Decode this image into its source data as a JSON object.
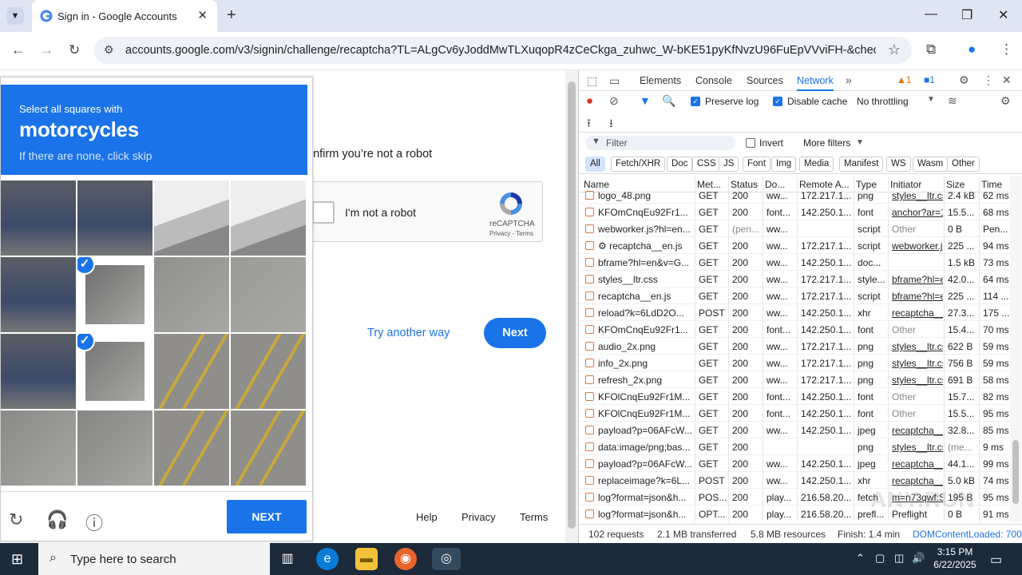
{
  "browser": {
    "tab_title": "Sign in - Google Accounts",
    "url": "accounts.google.com/v3/signin/challenge/recaptcha?TL=ALgCv6yJoddMwTLXuqopR4zCeCkga_zuhwc_W-bKE51pyKfNvzU96FuEpVVviFH-&checkConn..."
  },
  "page": {
    "robot_line": "onfirm you’re not a robot",
    "checkbox_label": "I'm not a robot",
    "recaptcha_brand": "reCAPTCHA",
    "privacy_terms": "Privacy - Terms",
    "try_another": "Try another way",
    "next": "Next",
    "footer": {
      "help": "Help",
      "privacy": "Privacy",
      "terms": "Terms"
    }
  },
  "captcha": {
    "instruction": "Select all squares with",
    "target": "motorcycles",
    "hint": "If there are none, click skip",
    "verify": "NEXT",
    "selected_tiles": [
      5,
      9
    ]
  },
  "devtools": {
    "tabs": [
      "Elements",
      "Console",
      "Sources",
      "Network"
    ],
    "active_tab": "Network",
    "warnings": "1",
    "messages": "1",
    "preserve_log": "Preserve log",
    "disable_cache": "Disable cache",
    "throttling": "No throttling",
    "filter_placeholder": "Filter",
    "invert": "Invert",
    "more_filters": "More filters",
    "type_filters": [
      "All",
      "Fetch/XHR",
      "Doc",
      "CSS",
      "JS",
      "Font",
      "Img",
      "Media",
      "Manifest",
      "WS",
      "Wasm",
      "Other"
    ],
    "columns": [
      "Name",
      "Met...",
      "Status",
      "Do...",
      "Remote A...",
      "Type",
      "Initiator",
      "Size",
      "Time"
    ],
    "rows": [
      [
        "logo_48.png",
        "GET",
        "200",
        "ww...",
        "172.217.1...",
        "png",
        "styles__ltr.css",
        "2.4 kB",
        "62 ms"
      ],
      [
        "KFOmCnqEu92Fr1...",
        "GET",
        "200",
        "font...",
        "142.250.1...",
        "font",
        "anchor?ar=1",
        "15.5...",
        "68 ms"
      ],
      [
        "webworker.js?hl=en...",
        "GET",
        "(pen...",
        "ww...",
        "",
        "script",
        "Other",
        "0 B",
        "Pen..."
      ],
      [
        "⚙ recaptcha__en.js",
        "GET",
        "200",
        "ww...",
        "172.217.1...",
        "script",
        "webworker.js",
        "225 ...",
        "94 ms"
      ],
      [
        "bframe?hl=en&v=G...",
        "GET",
        "200",
        "ww...",
        "142.250.1...",
        "doc...",
        "",
        "1.5 kB",
        "73 ms"
      ],
      [
        "styles__ltr.css",
        "GET",
        "200",
        "ww...",
        "172.217.1...",
        "style...",
        "bframe?hl=e",
        "42.0...",
        "64 ms"
      ],
      [
        "recaptcha__en.js",
        "GET",
        "200",
        "ww...",
        "172.217.1...",
        "script",
        "bframe?hl=e",
        "225 ...",
        "114 ..."
      ],
      [
        "reload?k=6LdD2O...",
        "POST",
        "200",
        "ww...",
        "142.250.1...",
        "xhr",
        "recaptcha__e",
        "27.3...",
        "175 ..."
      ],
      [
        "KFOmCnqEu92Fr1...",
        "GET",
        "200",
        "font...",
        "142.250.1...",
        "font",
        "Other",
        "15.4...",
        "70 ms"
      ],
      [
        "audio_2x.png",
        "GET",
        "200",
        "ww...",
        "172.217.1...",
        "png",
        "styles__ltr.css",
        "622 B",
        "59 ms"
      ],
      [
        "info_2x.png",
        "GET",
        "200",
        "ww...",
        "172.217.1...",
        "png",
        "styles__ltr.css",
        "756 B",
        "59 ms"
      ],
      [
        "refresh_2x.png",
        "GET",
        "200",
        "ww...",
        "172.217.1...",
        "png",
        "styles__ltr.css",
        "691 B",
        "58 ms"
      ],
      [
        "KFOlCnqEu92Fr1M...",
        "GET",
        "200",
        "font...",
        "142.250.1...",
        "font",
        "Other",
        "15.7...",
        "82 ms"
      ],
      [
        "KFOlCnqEu92Fr1M...",
        "GET",
        "200",
        "font...",
        "142.250.1...",
        "font",
        "Other",
        "15.5...",
        "95 ms"
      ],
      [
        "payload?p=06AFcW...",
        "GET",
        "200",
        "ww...",
        "142.250.1...",
        "jpeg",
        "recaptcha__e",
        "32.8...",
        "85 ms"
      ],
      [
        "data:image/png;bas...",
        "GET",
        "200",
        "",
        "",
        "png",
        "styles__ltr.css",
        "(me...",
        "9 ms"
      ],
      [
        "payload?p=06AFcW...",
        "GET",
        "200",
        "ww...",
        "142.250.1...",
        "jpeg",
        "recaptcha__e",
        "44.1...",
        "99 ms"
      ],
      [
        "replaceimage?k=6L...",
        "POST",
        "200",
        "ww...",
        "142.250.1...",
        "xhr",
        "recaptcha__e",
        "5.0 kB",
        "74 ms"
      ],
      [
        "log?format=json&h...",
        "POS...",
        "200",
        "play...",
        "216.58.20...",
        "fetch",
        "m=n73qwf:S",
        "195 B",
        "95 ms"
      ],
      [
        "log?format=json&h...",
        "OPT...",
        "200",
        "play...",
        "216.58.20...",
        "prefl...",
        "Preflight",
        "0 B",
        "91 ms"
      ]
    ],
    "status_bar": {
      "requests": "102 requests",
      "transferred": "2.1 MB transferred",
      "resources": "5.8 MB resources",
      "finish": "Finish: 1.4 min",
      "dcl": "DOMContentLoaded: 700"
    }
  },
  "taskbar": {
    "search_placeholder": "Type here to search",
    "time": "3:15 PM",
    "date": "6/22/2025"
  },
  "watermark": "ANY.RUN"
}
